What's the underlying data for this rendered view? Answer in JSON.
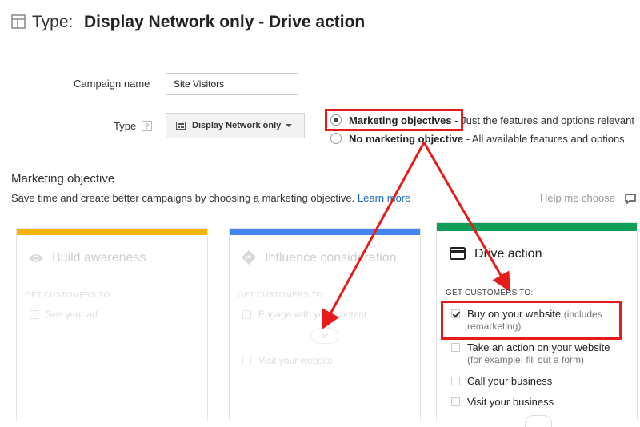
{
  "header": {
    "icon": "layout-grid-icon",
    "prefix": "Type:",
    "title": "Display Network only - Drive action"
  },
  "form": {
    "campaign_name_label": "Campaign name",
    "campaign_name_value": "Site Visitors",
    "type_label": "Type",
    "type_help": "?",
    "type_dropdown": "Display Network only",
    "options": [
      {
        "bold": "Marketing objectives",
        "rest": " - Just the features and options relevant",
        "selected": true
      },
      {
        "bold": "No marketing objective",
        "rest": " - All available features and options",
        "selected": false
      }
    ]
  },
  "objective": {
    "title": "Marketing objective",
    "desc": "Save time and create better campaigns by choosing a marketing objective.",
    "learn_more": "Learn more",
    "help_me_choose": "Help me choose",
    "cards": [
      {
        "title": "Build awareness",
        "icon": "eye-icon",
        "bar_color": "#f4b400",
        "get": "GET CUSTOMERS TO:",
        "items": [
          "See your ad"
        ]
      },
      {
        "title": "Influence consideration",
        "icon": "diamond-arrow-icon",
        "bar_color": "#4285f4",
        "get": "GET CUSTOMERS TO:",
        "items": [
          "Engage with your content",
          "Visit your website"
        ],
        "or": "or"
      },
      {
        "title": "Drive action",
        "icon": "credit-card-icon",
        "bar_color": "#0f9d58",
        "get": "GET CUSTOMERS TO:",
        "items": [
          {
            "text": "Buy on your website",
            "note": "(includes",
            "note2": "remarketing)",
            "checked": true
          },
          {
            "text": "Take an action on your website",
            "note2": "(for example, fill out a form)",
            "checked": false
          },
          {
            "text": "Call your business",
            "checked": false
          },
          {
            "text": "Visit your business",
            "checked": false
          }
        ]
      }
    ]
  },
  "colors": {
    "annotation": "#e81b1b",
    "link": "#1a66c8"
  }
}
